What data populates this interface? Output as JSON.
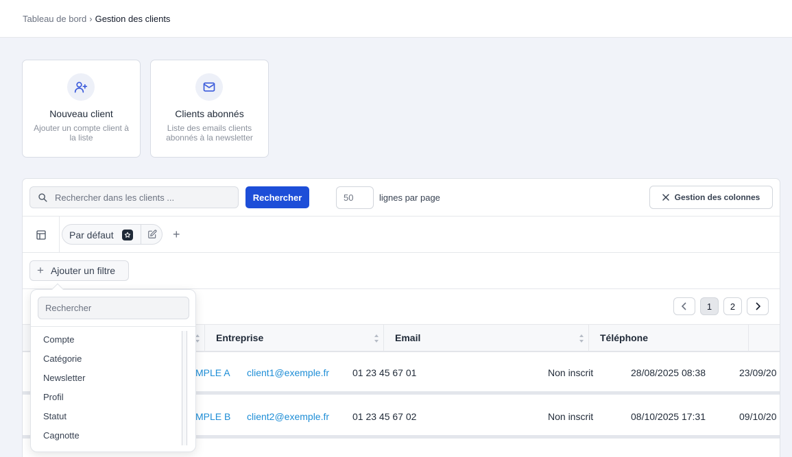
{
  "breadcrumb": {
    "parent": "Tableau de bord",
    "separator": "›",
    "current": "Gestion des clients"
  },
  "cards": [
    {
      "icon": "user-plus-icon",
      "title": "Nouveau client",
      "desc_line1": "Ajouter un compte client à",
      "desc_line2": "la liste"
    },
    {
      "icon": "mail-icon",
      "title": "Clients abonnés",
      "desc_line1": "Liste des emails clients",
      "desc_line2": "abonnés à la newsletter"
    }
  ],
  "toolbar": {
    "search_placeholder": "Rechercher dans les clients ...",
    "search_button": "Rechercher",
    "rows_per_page": "50",
    "rows_per_page_label": "lignes par page",
    "columns_button": "Gestion des colonnes"
  },
  "views": {
    "default_label": "Par défaut",
    "add": "+"
  },
  "filter": {
    "add_label": "Ajouter un filtre"
  },
  "pagination": {
    "pages": [
      "1",
      "2"
    ],
    "current": "1"
  },
  "table": {
    "headers": [
      "Entreprise",
      "Email",
      "Téléphone"
    ],
    "rows": [
      {
        "company": "MPLE A",
        "email": "client1@exemple.fr",
        "phone": "01 23 45 67 01",
        "newsletter": "Non inscrit",
        "created": "28/08/2025 08:38",
        "updated": "23/09/20"
      },
      {
        "company": "MPLE B",
        "email": "client2@exemple.fr",
        "phone": "01 23 45 67 02",
        "newsletter": "Non inscrit",
        "created": "08/10/2025 17:31",
        "updated": "09/10/20"
      }
    ]
  },
  "filter_dropdown": {
    "search_placeholder": "Rechercher",
    "items": [
      "Compte",
      "Catégorie",
      "Newsletter",
      "Profil",
      "Statut",
      "Cagnotte"
    ]
  },
  "colors": {
    "primary": "#1d4ed8",
    "link": "#1d8dd6",
    "background": "#f1f3f9"
  }
}
